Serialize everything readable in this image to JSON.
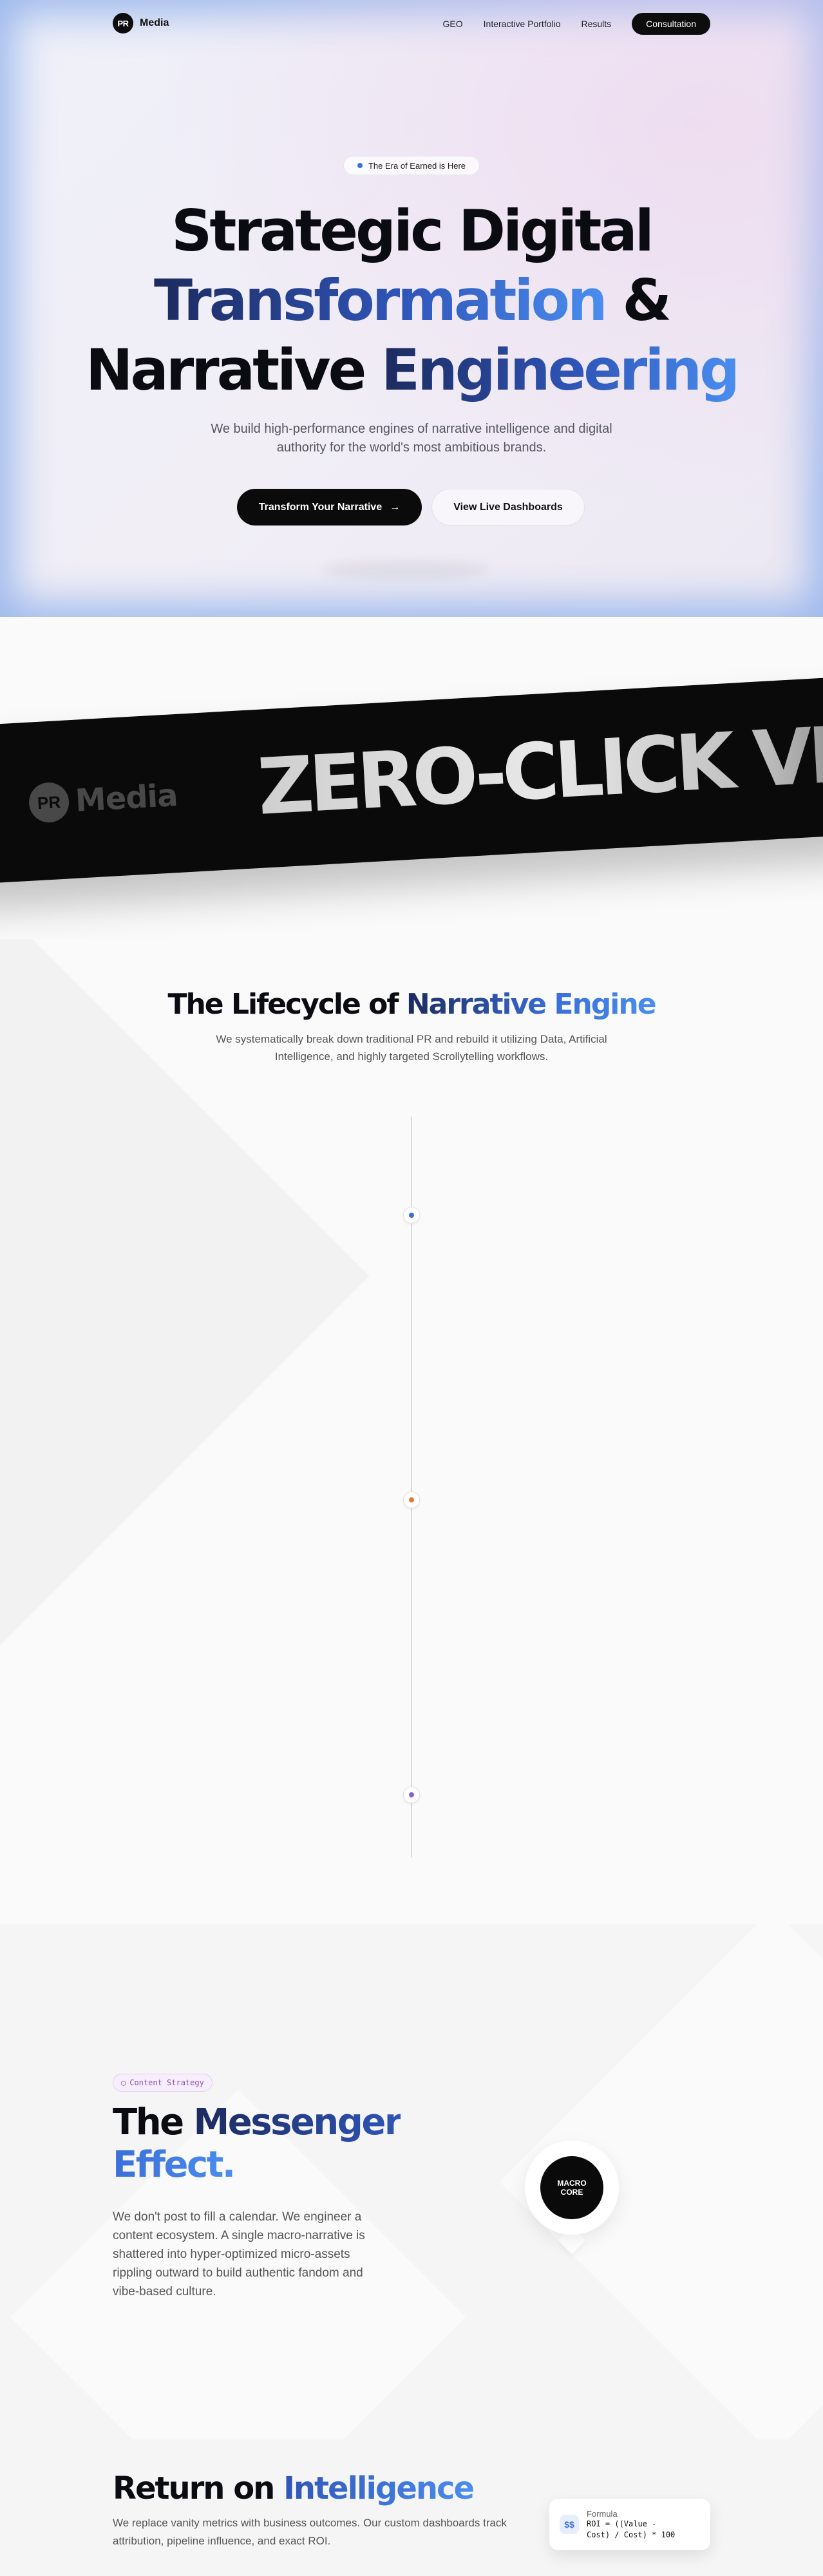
{
  "brand": {
    "logo_text": "PR",
    "name": "Media"
  },
  "nav": {
    "links": [
      "GEO",
      "Interactive Portfolio",
      "Results"
    ],
    "cta": "Consultation"
  },
  "hero": {
    "pill": "The Era of Earned is Here",
    "headline": {
      "line1": "Strategic Digital",
      "line2_grad": "Transformation",
      "line2_rest": "&",
      "line3_a": "Narrative",
      "line3_b": "Engineering"
    },
    "subhead": "We build high-performance engines of narrative intelligence and digital authority for the world's most ambitious brands.",
    "primary_cta": "Transform Your Narrative",
    "secondary_cta": "View Live Dashboards"
  },
  "band": {
    "logo_text": "PR",
    "logo_name": "Media",
    "text": "ZERO-CLICK VISIBI"
  },
  "lifecycle": {
    "title_a": "The Lifecycle of",
    "title_b": "Narrative Engine",
    "subtitle": "We systematically break down traditional PR and rebuild it utilizing Data, Artificial Intelligence, and highly targeted Scrollytelling workflows.",
    "node_colors": [
      "#3a6fd9",
      "#e07a3a",
      "#8a5fd1"
    ]
  },
  "messenger": {
    "tag": "Content Strategy",
    "title_a": "The",
    "title_b": "Messenger",
    "title_c": "Effect.",
    "body": "We don't post to fill a calendar. We engineer a content ecosystem. A single macro-narrative is shattered into hyper-optimized micro-assets rippling outward to build authentic fandom and vibe-based culture.",
    "core_label": "MACRO\nCORE"
  },
  "roi": {
    "title_a": "Return on",
    "title_b": "Intelligence",
    "body": "We replace vanity metrics with business outcomes. Our custom dashboards track attribution, pipeline influence, and exact ROI.",
    "formula_icon": "$$",
    "formula_label": "Formula",
    "formula_code": "ROI = ((Value - Cost) / Cost) * 100"
  }
}
